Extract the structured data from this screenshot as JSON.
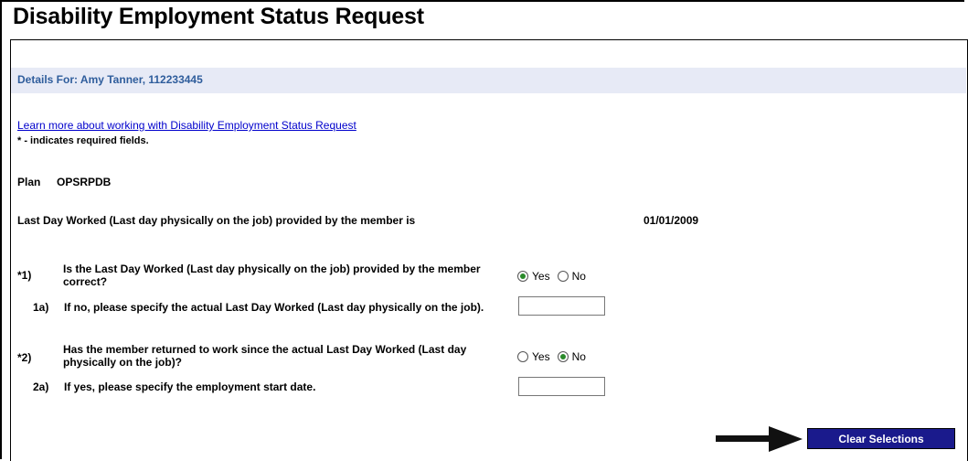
{
  "page": {
    "title": "Disability Employment Status Request",
    "details": "Details For: Amy Tanner, 112233445",
    "learn_link": "Learn more about working with Disability Employment Status Request",
    "required_note": "* - indicates required fields."
  },
  "plan": {
    "label": "Plan",
    "value": "OPSRPDB"
  },
  "last_day": {
    "label": "Last Day Worked (Last day physically on the job) provided by the member is",
    "value": "01/01/2009"
  },
  "questions": {
    "q1": {
      "num": "*1)",
      "text_line1": "Is the Last Day Worked (Last day physically on the job) provided by the member",
      "text_line2": "correct?",
      "yes_label": "Yes",
      "no_label": "No",
      "selected": "Yes"
    },
    "q1a": {
      "num": "1a)",
      "text": "If no, please specify the actual Last Day Worked (Last day physically on the job).",
      "value": ""
    },
    "q2": {
      "num": "*2)",
      "text_line1": "Has the member returned to work since the actual Last Day Worked (Last day",
      "text_line2": "physically on the job)?",
      "yes_label": "Yes",
      "no_label": "No",
      "selected": "No"
    },
    "q2a": {
      "num": "2a)",
      "text": "If yes, please specify the employment start date.",
      "value": ""
    }
  },
  "actions": {
    "clear_label": "Clear Selections"
  }
}
